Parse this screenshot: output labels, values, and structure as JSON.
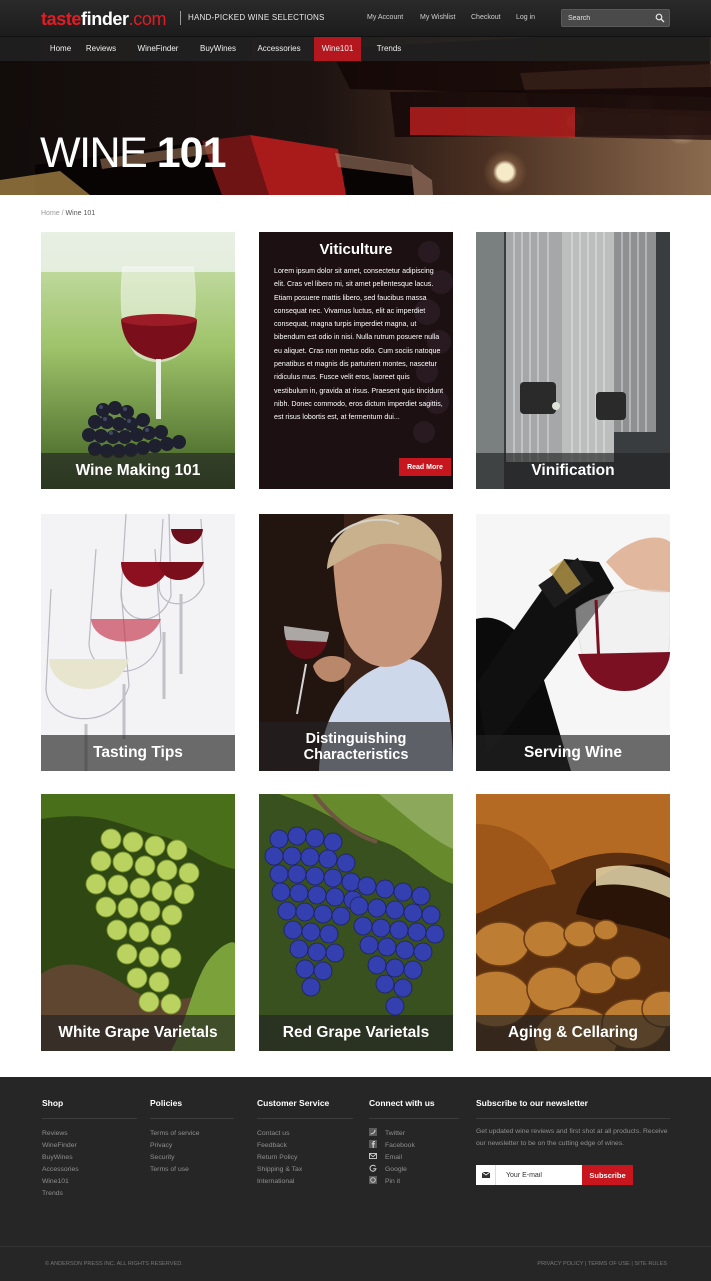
{
  "header": {
    "logo_taste": "taste",
    "logo_finder": "finder",
    "logo_com": ".com",
    "tagline": "HAND-PICKED WINE SELECTIONS",
    "links": [
      "My Account",
      "My Wishlist",
      "Checkout",
      "Log in"
    ],
    "search_placeholder": "Search"
  },
  "nav": {
    "items": [
      "Home",
      "Reviews",
      "WineFinder",
      "BuyWines",
      "Accessories",
      "Wine101",
      "Trends"
    ],
    "active": "Wine101",
    "active_color": "#b5171f"
  },
  "hero": {
    "title_light": "WINE",
    "title_bold": "101"
  },
  "breadcrumb": {
    "home": "Home",
    "separator": "/",
    "current": "Wine 101"
  },
  "tiles": [
    {
      "label": "Wine Making 101"
    },
    {
      "title": "Viticulture",
      "body": "Lorem ipsum dolor sit amet, consectetur adipiscing elit. Cras vel libero mi, sit amet pellentesque lacus. Etiam posuere mattis libero, sed faucibus massa consequat nec. Vivamus luctus, elit ac imperdiet consequat, magna turpis imperdiet magna, ut bibendum est odio in nisi. Nulla rutrum posuere nulla eu aliquet. Cras non metus odio. Cum sociis natoque penatibus et magnis dis parturient montes, nascetur ridiculus mus. Fusce velit eros, laoreet quis vestibulum in, gravida at risus. Praesent quis tincidunt nibh. Donec commodo, eros dictum imperdiet sagittis, est risus lobortis est, at fermentum dui...",
      "button": "Read More"
    },
    {
      "label": "Vinification"
    },
    {
      "label": "Tasting Tips"
    },
    {
      "label_line1": "Distinguishing",
      "label_line2": "Characteristics"
    },
    {
      "label": "Serving Wine"
    },
    {
      "label": "White Grape Varietals"
    },
    {
      "label": "Red Grape Varietals"
    },
    {
      "label": "Aging & Cellaring"
    }
  ],
  "footer": {
    "shop": {
      "heading": "Shop",
      "links": [
        "Reviews",
        "WineFinder",
        "BuyWines",
        "Accessories",
        "Wine101",
        "Trends"
      ]
    },
    "policies": {
      "heading": "Policies",
      "links": [
        "Terms of service",
        "Privacy",
        "Security",
        "Terms of use"
      ]
    },
    "customer_service": {
      "heading": "Customer Service",
      "links": [
        "Contact us",
        "Feedback",
        "Return Policy",
        "Shipping & Tax",
        "International"
      ]
    },
    "connect": {
      "heading": "Connect with us",
      "links": [
        {
          "label": "Twitter",
          "icon": "twitter-icon"
        },
        {
          "label": "Facebook",
          "icon": "facebook-icon"
        },
        {
          "label": "Email",
          "icon": "email-icon"
        },
        {
          "label": "Google",
          "icon": "google-icon"
        },
        {
          "label": "Pin it",
          "icon": "pinterest-icon"
        }
      ]
    },
    "newsletter": {
      "heading": "Subscribe to our newsletter",
      "text": "Get updated wine reviews and first shot at all products. Receive our newsletter to be on the cutting edge of wines.",
      "placeholder": "Your E-mail",
      "button": "Subscribe"
    },
    "copyright": "© ANDERSON PRESS INC.   ALL RIGHTS RESERVED.",
    "legal": "PRIVACY POLICY | TERMS OF USE | SITE RULES"
  }
}
